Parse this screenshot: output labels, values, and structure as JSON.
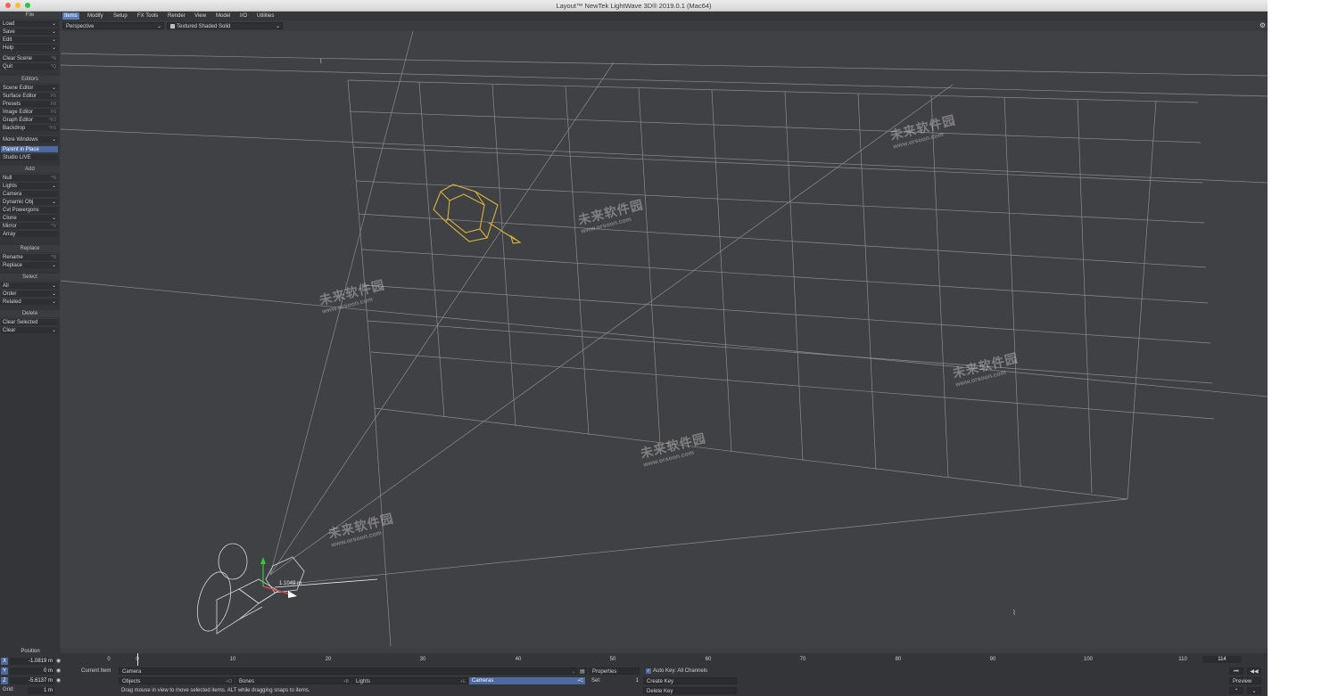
{
  "window": {
    "title": "Layout™ NewTek LightWave 3D® 2019.0.1 (Mac64)",
    "traffic_lights": [
      "#fc5f57",
      "#fdbc2e",
      "#28c840"
    ]
  },
  "tabs": [
    "Items",
    "Modify",
    "Setup",
    "FX Tools",
    "Render",
    "View",
    "Model",
    "I/O",
    "Utilities"
  ],
  "viewport_header": {
    "view_mode": "Perspective",
    "shading": "Textured Shaded Solid"
  },
  "toolbar": {
    "file": {
      "header": "File",
      "load": "Load",
      "save": "Save",
      "edit": "Edit",
      "help": "Help",
      "clear_scene": "Clear Scene",
      "clear_scene_key": "^N",
      "quit": "Quit",
      "quit_key": "^Q"
    },
    "editors": {
      "header": "Editors",
      "scene_editor": "Scene Editor",
      "surface_editor": "Surface Editor",
      "surface_editor_key": "F5",
      "presets": "Presets",
      "presets_key": "F8",
      "image_editor": "Image Editor",
      "image_editor_key": "F6",
      "graph_editor": "Graph Editor",
      "graph_editor_key": "^F2",
      "backdrop": "Backdrop",
      "backdrop_key": "^F5",
      "more_windows": "More Windows",
      "parent_in_place": "Parent in Place",
      "studio_live": "Studio LIVE"
    },
    "add": {
      "header": "Add",
      "null": "Null",
      "null_key": "^N",
      "lights": "Lights",
      "camera": "Camera",
      "dynamic_obj": "Dynamic Obj",
      "cvt_powergons": "Cvt Powergons",
      "clone": "Clone",
      "mirror": "Mirror",
      "mirror_key": "^V",
      "array": "Array"
    },
    "replace": {
      "header": "Replace",
      "rename": "Rename",
      "rename_key": "^N",
      "replace": "Replace"
    },
    "select": {
      "header": "Select",
      "all": "All",
      "order": "Order",
      "related": "Related"
    },
    "delete": {
      "header": "Delete",
      "clear_selected": "Clear Selected",
      "clear": "Clear"
    }
  },
  "viewport": {
    "distance_label": "1.1049 m"
  },
  "timeline": {
    "ticks": [
      "0",
      "10",
      "20",
      "30",
      "40",
      "50",
      "60",
      "70",
      "80",
      "90",
      "100",
      "110"
    ],
    "start": "0",
    "current_frame": "0",
    "end_frame": "114"
  },
  "position": {
    "header": "Position",
    "x_label": "X",
    "x_value": "-1.0819 m",
    "y_label": "Y",
    "y_value": "0 m",
    "z_label": "Z",
    "z_value": "-5.6137 m",
    "grid_label": "Grid:",
    "grid_value": "1 m"
  },
  "bottom": {
    "current_item_label": "Current Item",
    "current_item": "Camera",
    "properties": "Properties",
    "auto_key": "Auto Key: All Channels",
    "objects": "Objects",
    "objects_key": "+O",
    "bones": "Bones",
    "bones_key": "+B",
    "lights": "Lights",
    "lights_key": "+L",
    "cameras": "Cameras",
    "cameras_key": "+C",
    "sel_label": "Sel:",
    "sel_value": "1",
    "create_key": "Create Key",
    "delete_key": "Delete Key",
    "preview": "Preview",
    "status": "Drag mouse in view to move selected items. ALT while dragging snaps to items."
  },
  "watermark": {
    "brand": "未来软件园",
    "url": "www.orsoon.com"
  },
  "colors": {
    "selected_object": "#d9b43a",
    "accent": "#4d6aa0",
    "grid_line": "#8c8d90"
  }
}
